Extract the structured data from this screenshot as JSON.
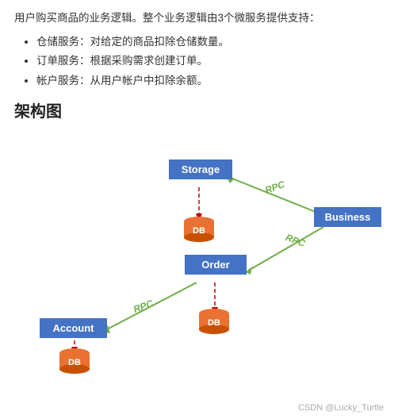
{
  "intro": {
    "text": "用户购买商品的业务逻辑。整个业务逻辑由3个微服务提供支持："
  },
  "bullets": [
    {
      "text": "仓储服务：对给定的商品扣除仓储数量。"
    },
    {
      "text": "订单服务：根据采购需求创建订单。"
    },
    {
      "text": "帐户服务：从用户帐户中扣除余额。"
    }
  ],
  "section": {
    "title": "架构图"
  },
  "nodes": {
    "storage": {
      "label": "Storage"
    },
    "order": {
      "label": "Order"
    },
    "account": {
      "label": "Account"
    },
    "business": {
      "label": "Business"
    },
    "db": "DB"
  },
  "edges": {
    "rpc": "RPC"
  },
  "watermark": "CSDN @Lucky_Turtle"
}
